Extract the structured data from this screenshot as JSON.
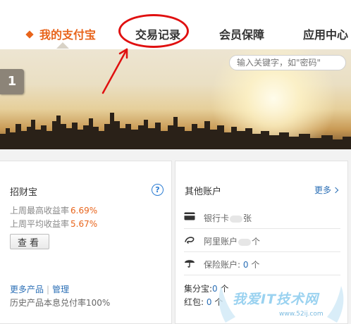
{
  "nav": {
    "items": [
      {
        "label": "我的支付宝"
      },
      {
        "label": "交易记录"
      },
      {
        "label": "会员保障"
      },
      {
        "label": "应用中心"
      }
    ]
  },
  "banner": {
    "search_placeholder": "输入关键字，如\"密码\"",
    "slide_number": "1"
  },
  "wealth_card": {
    "title": "招财宝",
    "help_icon": "?",
    "rows": [
      {
        "label": "上周最高收益率",
        "value": "6.69%"
      },
      {
        "label": "上周平均收益率",
        "value": "5.67%"
      }
    ],
    "view_button": "查看",
    "more_products": "更多产品",
    "separator": "|",
    "manage": "管理",
    "history_rate": "历史产品本息兑付率100%"
  },
  "other_accounts": {
    "title": "其他账户",
    "more_link": "更多",
    "accounts": [
      {
        "icon": "bank-card-icon",
        "label": "银行卡",
        "suffix": "张"
      },
      {
        "icon": "alibaba-icon",
        "label": "阿里账户",
        "suffix": "个"
      },
      {
        "icon": "umbrella-icon",
        "label": "保险账户:",
        "count": "0",
        "suffix": "个"
      }
    ],
    "points": {
      "label": "集分宝:",
      "value": "0",
      "suffix": "个"
    },
    "redpacket": {
      "label": "红包:",
      "value": "0",
      "suffix": "个"
    }
  },
  "watermark": {
    "text": "我爱IT技术网",
    "url": "www.52ij.com"
  },
  "colors": {
    "accent_orange": "#e8641b",
    "link_blue": "#2b6fb6",
    "annotation_red": "#e01010"
  }
}
